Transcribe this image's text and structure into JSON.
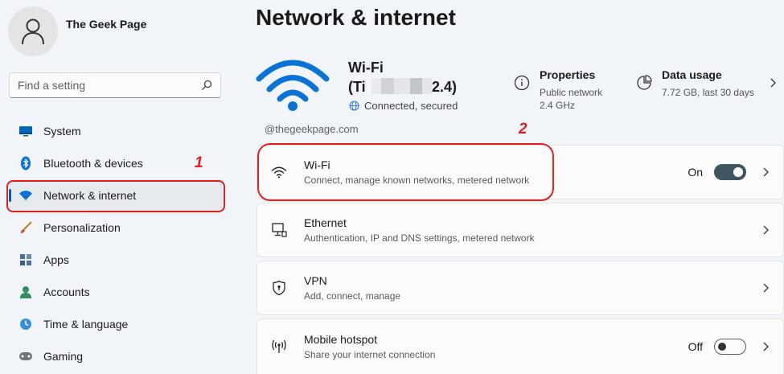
{
  "profile": {
    "name": "The Geek Page"
  },
  "search": {
    "placeholder": "Find a setting"
  },
  "nav": {
    "items": [
      {
        "label": "System"
      },
      {
        "label": "Bluetooth & devices"
      },
      {
        "label": "Network & internet"
      },
      {
        "label": "Personalization"
      },
      {
        "label": "Apps"
      },
      {
        "label": "Accounts"
      },
      {
        "label": "Time & language"
      },
      {
        "label": "Gaming"
      }
    ]
  },
  "annotations": {
    "one": "1",
    "two": "2"
  },
  "page": {
    "title": "Network & internet"
  },
  "hero": {
    "line1": "Wi-Fi",
    "line2_start": "(Ti",
    "line2_end": "2.4)",
    "status": "Connected, secured"
  },
  "properties": {
    "title": "Properties",
    "line1": "Public network",
    "line2": "2.4 GHz"
  },
  "data_usage": {
    "title": "Data usage",
    "line1": "7.72 GB, last 30 days"
  },
  "watermark": "@thegeekpage.com",
  "cards": {
    "wifi": {
      "title": "Wi-Fi",
      "subtitle": "Connect, manage known networks, metered network",
      "toggle_label": "On"
    },
    "ethernet": {
      "title": "Ethernet",
      "subtitle": "Authentication, IP and DNS settings, metered network"
    },
    "vpn": {
      "title": "VPN",
      "subtitle": "Add, connect, manage"
    },
    "hotspot": {
      "title": "Mobile hotspot",
      "subtitle": "Share your internet connection",
      "toggle_label": "Off"
    }
  },
  "colors": {
    "accent": "#005fb8",
    "annotation": "#e02020",
    "wifi_hero": "#0a74d6"
  }
}
